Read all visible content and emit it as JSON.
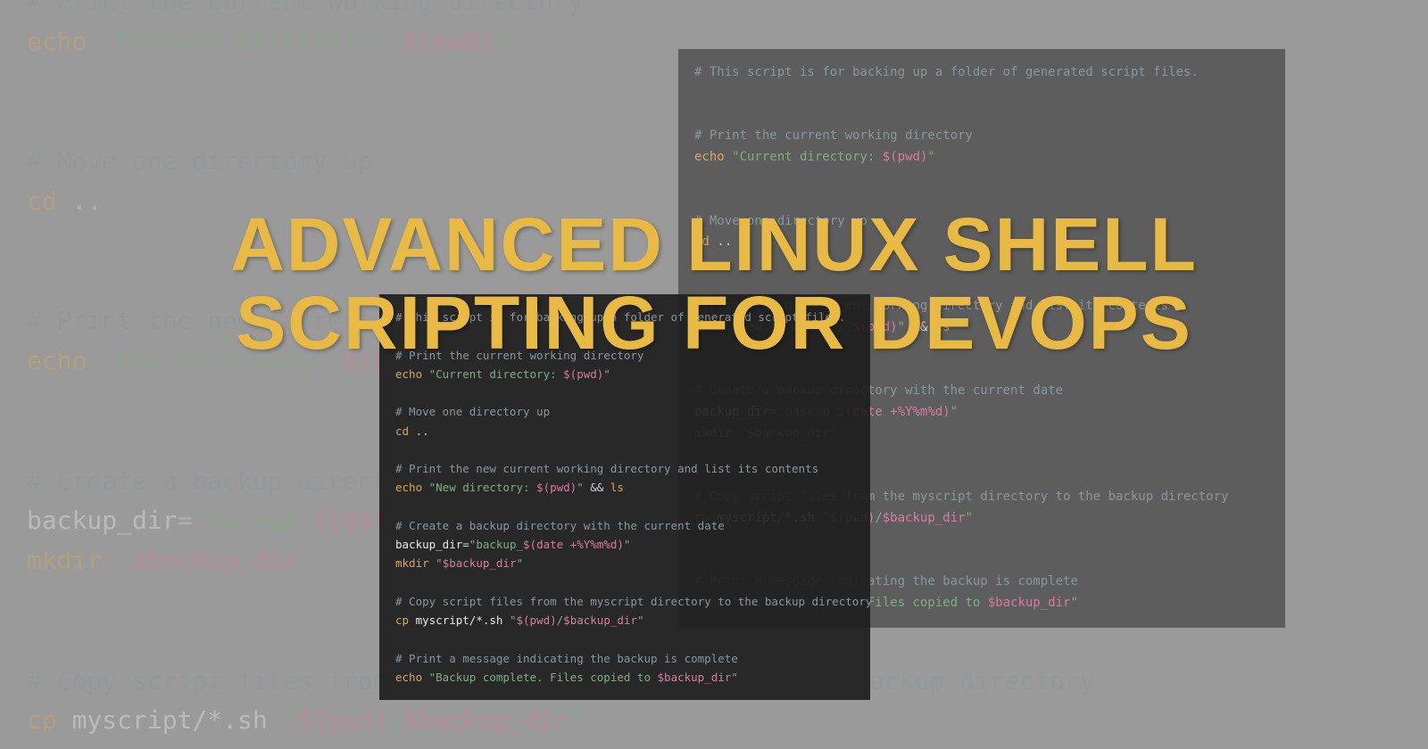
{
  "title": "ADVANCED LINUX SHELL SCRIPTING FOR DEVOPS",
  "code": {
    "c1": "# This script is for backing up a folder of generated script files.",
    "c2": "# Print the current working directory",
    "l2a": "echo",
    "l2b": " \"Current directory: ",
    "l2c": "$(pwd)",
    "l2d": "\"",
    "c3": "# Move one directory up",
    "l3a": "cd",
    "l3b": " ..",
    "c4": "# Print the new current working directory and list its contents",
    "l4a": "echo",
    "l4b": " \"New directory: ",
    "l4c": "$(pwd)",
    "l4d": "\"",
    "l4e": " && ",
    "l4f": "ls",
    "c5": "# Create a backup directory with the current date",
    "l5a": "backup_dir",
    "l5b": "=",
    "l5c": "\"backup_",
    "l5d": "$(date +%Y%m%d)",
    "l5e": "\"",
    "l5f": "mkdir",
    "l5g": " \"",
    "l5h": "$backup_dir",
    "l5i": "\"",
    "c6": "# Copy script files from the myscript directory to the backup directory",
    "l6a": "cp",
    "l6b": " myscript/*.sh ",
    "l6c": "\"",
    "l6d": "$(pwd)",
    "l6e": "/",
    "l6f": "$backup_dir",
    "l6g": "\"",
    "c7": "# Print a message indicating the backup is complete",
    "l7a": "echo",
    "l7b": " \"Backup complete. Files copied to ",
    "l7c": "$backup_dir",
    "l7d": "\""
  }
}
